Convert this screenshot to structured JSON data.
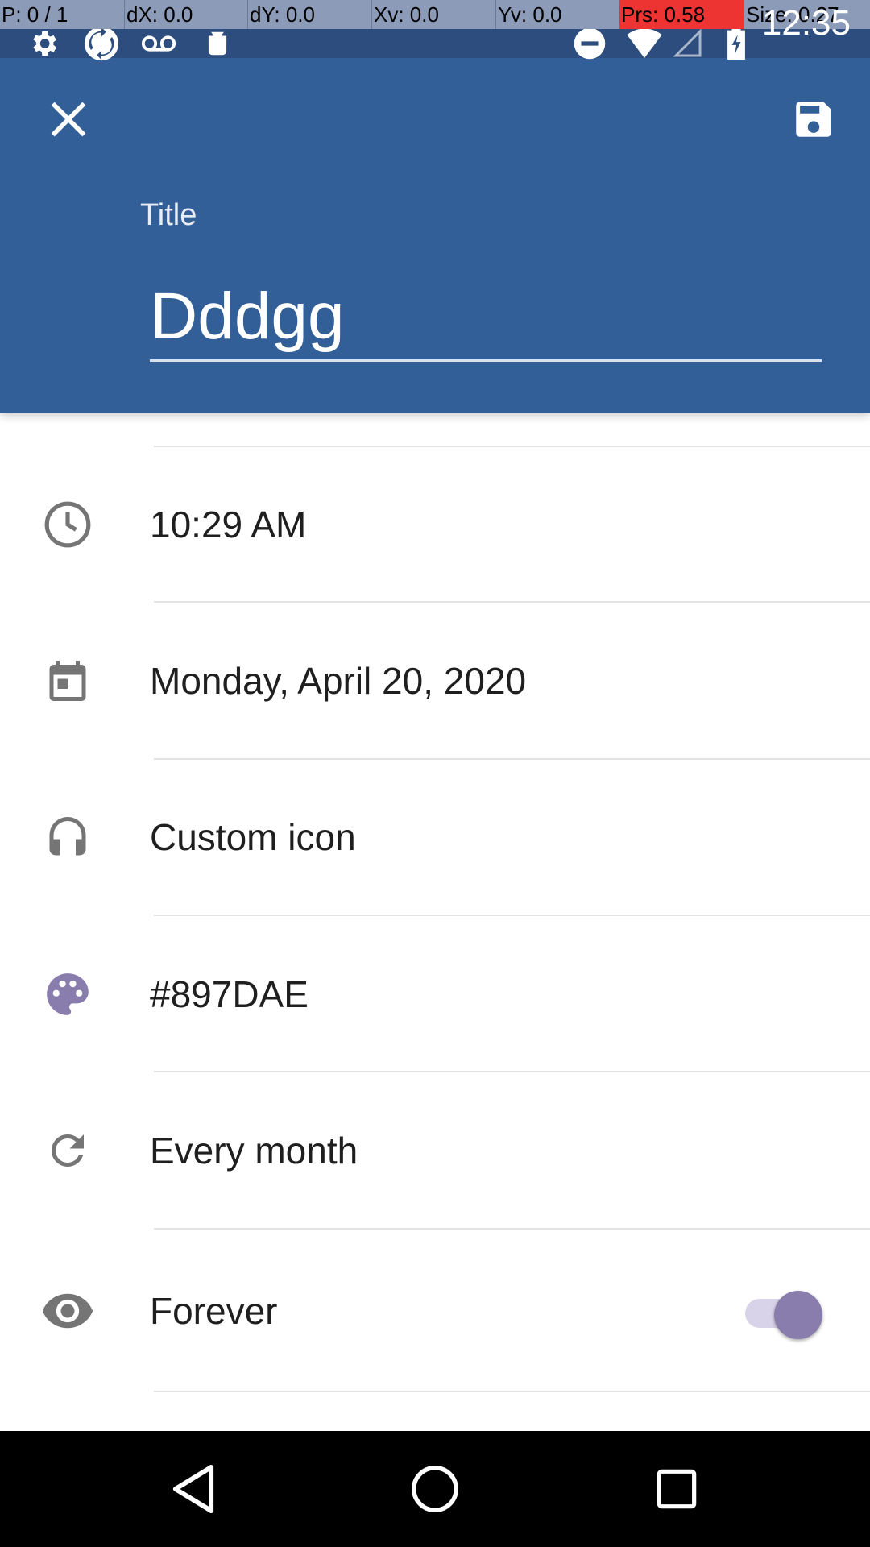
{
  "debug_overlay": {
    "pointer": "P: 0 / 1",
    "dx": "dX: 0.0",
    "dy": "dY: 0.0",
    "xv": "Xv: 0.0",
    "yv": "Yv: 0.0",
    "prs": "Prs: 0.58",
    "size": "Size: 0.27"
  },
  "status_bar": {
    "time": "12:35",
    "icons": [
      "settings-icon",
      "sync-icon",
      "voicemail-icon",
      "android-icon",
      "do-not-disturb-icon",
      "wifi-icon",
      "signal-icon",
      "battery-charging-icon"
    ]
  },
  "app_bar": {
    "close_icon": "close-icon",
    "save_icon": "save-icon",
    "title_label": "Title",
    "title_value": "Dddgg"
  },
  "settings": [
    {
      "icon": "clock-icon",
      "label": "10:29 AM"
    },
    {
      "icon": "calendar-icon",
      "label": "Monday, April 20, 2020"
    },
    {
      "icon": "headphones-icon",
      "label": "Custom icon"
    },
    {
      "icon": "palette-icon",
      "label": "#897DAE"
    },
    {
      "icon": "repeat-icon",
      "label": "Every month"
    },
    {
      "icon": "eye-icon",
      "label": "Forever",
      "toggle_on": true
    }
  ],
  "colors": {
    "app_bar": "#335f99",
    "status_bar": "#2c4d7e",
    "accent": "#897dae",
    "icon_gray": "#757575"
  },
  "nav_bar": {
    "buttons": [
      "back-icon",
      "home-icon",
      "recents-icon"
    ]
  }
}
